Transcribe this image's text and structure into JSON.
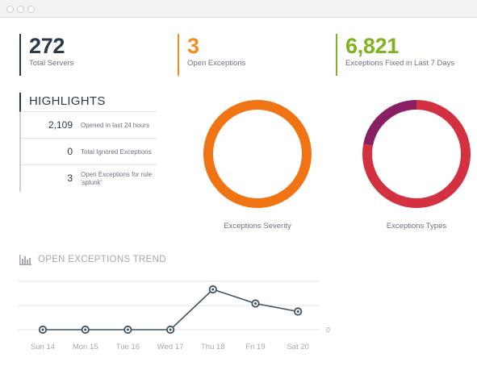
{
  "stats": [
    {
      "value": "272",
      "label": "Total Servers",
      "color": "#2b3a4a"
    },
    {
      "value": "3",
      "label": "Open Exceptions",
      "color": "#f28c1e"
    },
    {
      "value": "6,821",
      "label": "Exceptions Fixed in Last 7 Days",
      "color": "#7fb21f"
    }
  ],
  "highlights": {
    "title": "HIGHLIGHTS",
    "items": [
      {
        "value": "2,109",
        "label": "Opened in last 24 hours"
      },
      {
        "value": "0",
        "label": "Total Ignored Exceptions"
      },
      {
        "value": "3",
        "label": "Open Exceptions for rule 'splunk'"
      }
    ]
  },
  "donuts": [
    {
      "label": "Exceptions Severity",
      "slices": [
        {
          "fraction": 1.0,
          "color": "#f07314"
        }
      ]
    },
    {
      "label": "Exceptions Types",
      "slices": [
        {
          "fraction": 0.78,
          "color": "#d33142"
        },
        {
          "fraction": 0.22,
          "color": "#8b1f63"
        }
      ]
    }
  ],
  "trend": {
    "title": "OPEN EXCEPTIONS TREND",
    "icon": "bar-chart-icon",
    "y_tick": "0",
    "chart_data": {
      "type": "line",
      "title": "OPEN EXCEPTIONS TREND",
      "categories": [
        "Sun 14",
        "Mon 15",
        "Tue 16",
        "Wed 17",
        "Thu 18",
        "Fri 19",
        "Sat 20"
      ],
      "values": [
        0,
        0,
        0,
        0,
        1,
        0.65,
        0.45
      ],
      "ylim": [
        0,
        1.2
      ],
      "yticks": [
        "0"
      ],
      "grid": true,
      "line_color": "#3f5262"
    }
  }
}
